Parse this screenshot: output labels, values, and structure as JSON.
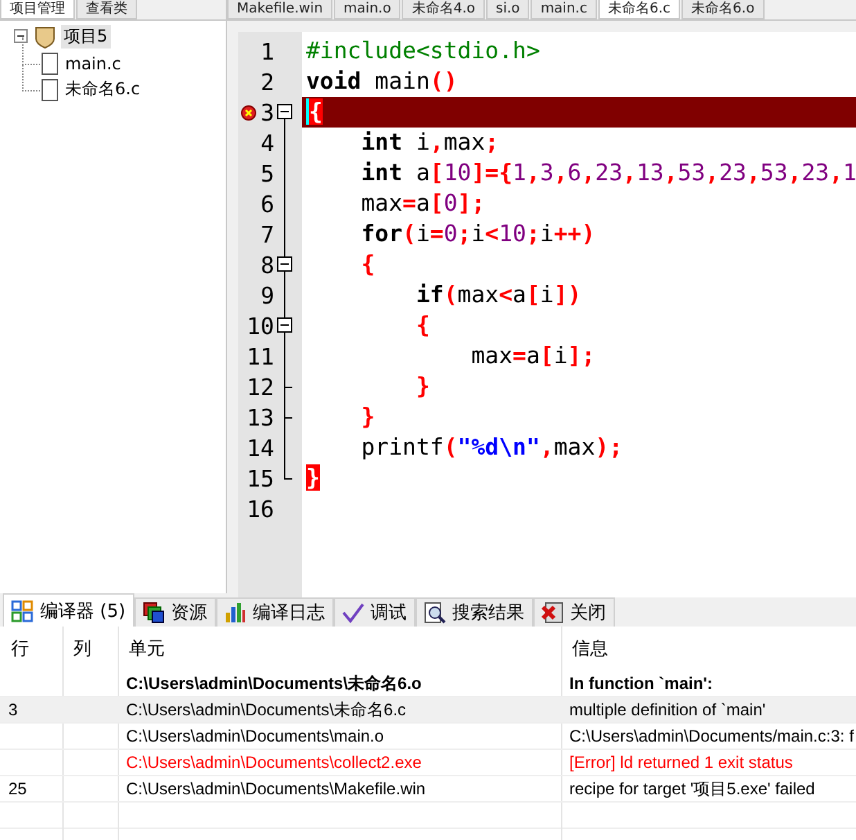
{
  "left_tabs": [
    {
      "label": "项目管理",
      "selected": true
    },
    {
      "label": "查看类",
      "selected": false
    }
  ],
  "editor_tabs": [
    {
      "label": "Makefile.win",
      "selected": false
    },
    {
      "label": "main.o",
      "selected": false
    },
    {
      "label": "未命名4.o",
      "selected": false
    },
    {
      "label": "si.o",
      "selected": false
    },
    {
      "label": "main.c",
      "selected": false
    },
    {
      "label": "未命名6.c",
      "selected": true
    },
    {
      "label": "未命名6.o",
      "selected": false
    }
  ],
  "project_tree": {
    "label": "项目5",
    "expanded": true,
    "selected": true,
    "children": [
      {
        "label": "main.c",
        "selected": false
      },
      {
        "label": "未命名6.c",
        "selected": false
      }
    ]
  },
  "code_lines": [
    {
      "number": "1",
      "collapsible": false,
      "block_end": false,
      "error": false,
      "bracket_match": false,
      "segments": [
        {
          "kind": "pre",
          "text": "#include<stdio.h>"
        }
      ]
    },
    {
      "number": "2",
      "collapsible": false,
      "block_end": false,
      "error": false,
      "bracket_match": false,
      "segments": [
        {
          "kind": "kw",
          "text": "void"
        },
        {
          "kind": "plain",
          "text": " main"
        },
        {
          "kind": "sym",
          "text": "()"
        }
      ]
    },
    {
      "number": "3",
      "collapsible": true,
      "block_end": false,
      "error": true,
      "bracket_match": true,
      "segments": [
        {
          "kind": "sym",
          "text": "{"
        }
      ]
    },
    {
      "number": "4",
      "collapsible": false,
      "block_end": false,
      "error": false,
      "bracket_match": false,
      "segments": [
        {
          "kind": "kw",
          "text": "    int"
        },
        {
          "kind": "plain",
          "text": " i"
        },
        {
          "kind": "sym",
          "text": ","
        },
        {
          "kind": "plain",
          "text": "max"
        },
        {
          "kind": "sym",
          "text": ";"
        }
      ]
    },
    {
      "number": "5",
      "collapsible": false,
      "block_end": false,
      "error": false,
      "bracket_match": false,
      "segments": [
        {
          "kind": "kw",
          "text": "    int"
        },
        {
          "kind": "plain",
          "text": " a"
        },
        {
          "kind": "sym",
          "text": "["
        },
        {
          "kind": "num",
          "text": "10"
        },
        {
          "kind": "sym",
          "text": "]={"
        },
        {
          "kind": "num",
          "text": "1"
        },
        {
          "kind": "sym",
          "text": ","
        },
        {
          "kind": "num",
          "text": "3"
        },
        {
          "kind": "sym",
          "text": ","
        },
        {
          "kind": "num",
          "text": "6"
        },
        {
          "kind": "sym",
          "text": ","
        },
        {
          "kind": "num",
          "text": "23"
        },
        {
          "kind": "sym",
          "text": ","
        },
        {
          "kind": "num",
          "text": "13"
        },
        {
          "kind": "sym",
          "text": ","
        },
        {
          "kind": "num",
          "text": "53"
        },
        {
          "kind": "sym",
          "text": ","
        },
        {
          "kind": "num",
          "text": "23"
        },
        {
          "kind": "sym",
          "text": ","
        },
        {
          "kind": "num",
          "text": "53"
        },
        {
          "kind": "sym",
          "text": ","
        },
        {
          "kind": "num",
          "text": "23"
        },
        {
          "kind": "sym",
          "text": ","
        },
        {
          "kind": "num",
          "text": "1"
        }
      ]
    },
    {
      "number": "6",
      "collapsible": false,
      "block_end": false,
      "error": false,
      "bracket_match": false,
      "segments": [
        {
          "kind": "plain",
          "text": "    max"
        },
        {
          "kind": "sym",
          "text": "="
        },
        {
          "kind": "plain",
          "text": "a"
        },
        {
          "kind": "sym",
          "text": "["
        },
        {
          "kind": "num",
          "text": "0"
        },
        {
          "kind": "sym",
          "text": "];"
        }
      ]
    },
    {
      "number": "7",
      "collapsible": false,
      "block_end": false,
      "error": false,
      "bracket_match": false,
      "segments": [
        {
          "kind": "kw",
          "text": "    for"
        },
        {
          "kind": "sym",
          "text": "("
        },
        {
          "kind": "plain",
          "text": "i"
        },
        {
          "kind": "sym",
          "text": "="
        },
        {
          "kind": "num",
          "text": "0"
        },
        {
          "kind": "sym",
          "text": ";"
        },
        {
          "kind": "plain",
          "text": "i"
        },
        {
          "kind": "sym",
          "text": "<"
        },
        {
          "kind": "num",
          "text": "10"
        },
        {
          "kind": "sym",
          "text": ";"
        },
        {
          "kind": "plain",
          "text": "i"
        },
        {
          "kind": "sym",
          "text": "++)"
        }
      ]
    },
    {
      "number": "8",
      "collapsible": true,
      "block_end": false,
      "error": false,
      "bracket_match": false,
      "segments": [
        {
          "kind": "sym",
          "text": "    {"
        }
      ]
    },
    {
      "number": "9",
      "collapsible": false,
      "block_end": false,
      "error": false,
      "bracket_match": false,
      "segments": [
        {
          "kind": "kw",
          "text": "        if"
        },
        {
          "kind": "sym",
          "text": "("
        },
        {
          "kind": "plain",
          "text": "max"
        },
        {
          "kind": "sym",
          "text": "<"
        },
        {
          "kind": "plain",
          "text": "a"
        },
        {
          "kind": "sym",
          "text": "["
        },
        {
          "kind": "plain",
          "text": "i"
        },
        {
          "kind": "sym",
          "text": "])"
        }
      ]
    },
    {
      "number": "10",
      "collapsible": true,
      "block_end": false,
      "error": false,
      "bracket_match": false,
      "segments": [
        {
          "kind": "sym",
          "text": "        {"
        }
      ]
    },
    {
      "number": "11",
      "collapsible": false,
      "block_end": false,
      "error": false,
      "bracket_match": false,
      "segments": [
        {
          "kind": "plain",
          "text": "            max"
        },
        {
          "kind": "sym",
          "text": "="
        },
        {
          "kind": "plain",
          "text": "a"
        },
        {
          "kind": "sym",
          "text": "["
        },
        {
          "kind": "plain",
          "text": "i"
        },
        {
          "kind": "sym",
          "text": "];"
        }
      ]
    },
    {
      "number": "12",
      "collapsible": false,
      "block_end": true,
      "error": false,
      "bracket_match": false,
      "segments": [
        {
          "kind": "sym",
          "text": "        }"
        }
      ]
    },
    {
      "number": "13",
      "collapsible": false,
      "block_end": true,
      "error": false,
      "bracket_match": false,
      "segments": [
        {
          "kind": "sym",
          "text": "    }"
        }
      ]
    },
    {
      "number": "14",
      "collapsible": false,
      "block_end": false,
      "error": false,
      "bracket_match": false,
      "segments": [
        {
          "kind": "plain",
          "text": "    printf"
        },
        {
          "kind": "sym",
          "text": "("
        },
        {
          "kind": "str",
          "text": "\"%d\\n\""
        },
        {
          "kind": "sym",
          "text": ","
        },
        {
          "kind": "plain",
          "text": "max"
        },
        {
          "kind": "sym",
          "text": ");"
        }
      ]
    },
    {
      "number": "15",
      "collapsible": false,
      "block_end": true,
      "error": false,
      "bracket_match": true,
      "segments": [
        {
          "kind": "sym",
          "text": "}"
        }
      ]
    },
    {
      "number": "16",
      "collapsible": false,
      "block_end": false,
      "error": false,
      "bracket_match": false
    }
  ],
  "bottom_tabs": [
    {
      "kind": "compiler",
      "label": "编译器 (5)",
      "selected": true
    },
    {
      "kind": "resources",
      "label": "资源",
      "selected": false
    },
    {
      "kind": "log",
      "label": "编译日志",
      "selected": false
    },
    {
      "kind": "debug",
      "label": "调试",
      "selected": false
    },
    {
      "kind": "search",
      "label": "搜索结果",
      "selected": false
    },
    {
      "kind": "close",
      "label": "关闭",
      "selected": false
    }
  ],
  "messages": {
    "columns": [
      "行",
      "列",
      "单元",
      "信息"
    ],
    "rows": [
      {
        "kind": "heading",
        "selected": false,
        "unit": "C:\\Users\\admin\\Documents\\未命名6.o",
        "message": "In function `main':"
      },
      {
        "kind": "normal",
        "selected": true,
        "line": "3",
        "unit": "C:\\Users\\admin\\Documents\\未命名6.c",
        "message": "multiple definition of `main'"
      },
      {
        "kind": "normal",
        "selected": false,
        "unit": "C:\\Users\\admin\\Documents\\main.o",
        "message": "C:\\Users\\admin\\Documents/main.c:3: f"
      },
      {
        "kind": "error",
        "selected": false,
        "unit": "C:\\Users\\admin\\Documents\\collect2.exe",
        "message": "[Error] ld returned 1 exit status"
      },
      {
        "kind": "normal",
        "selected": false,
        "line": "25",
        "unit": "C:\\Users\\admin\\Documents\\Makefile.win",
        "message": "recipe for target '项目5.exe' failed"
      }
    ]
  }
}
